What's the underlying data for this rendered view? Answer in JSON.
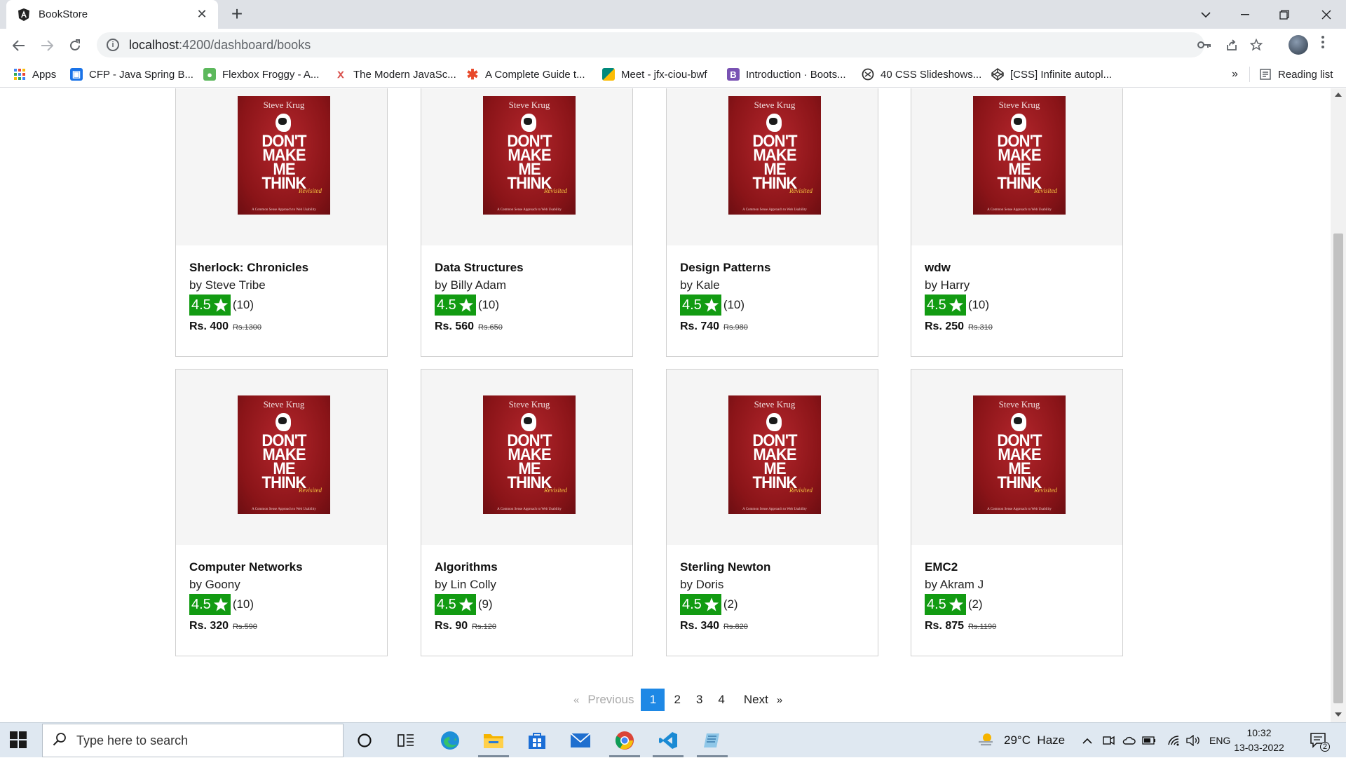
{
  "browser": {
    "tab_title": "BookStore",
    "tab_close": "✕",
    "new_tab": "+",
    "url_host": "localhost",
    "url_path": ":4200/dashboard/books",
    "reading_list": "Reading list",
    "bookmarks_more": "»"
  },
  "bookmarks": [
    {
      "label": "Apps",
      "icon": "apps-grid-icon",
      "color": "#4285f4"
    },
    {
      "label": "CFP - Java Spring B...",
      "icon": "cfp-icon",
      "color": "#1a73e8"
    },
    {
      "label": "Flexbox Froggy - A...",
      "icon": "frog-icon",
      "color": "#5cb85c"
    },
    {
      "label": "The Modern JavaSc...",
      "icon": "javascript-info-icon",
      "color": "#d9534f"
    },
    {
      "label": "A Complete Guide t...",
      "icon": "css-tricks-icon",
      "color": "#e8492a"
    },
    {
      "label": "Meet - jfx-ciou-bwf",
      "icon": "google-meet-icon",
      "color": "#00897b"
    },
    {
      "label": "Introduction · Boots...",
      "icon": "bootstrap-icon",
      "color": "#7952b3"
    },
    {
      "label": "40 CSS Slideshows...",
      "icon": "slideshow-icon",
      "color": "#333333"
    },
    {
      "label": "[CSS] Infinite autopl...",
      "icon": "codepen-icon",
      "color": "#333333"
    }
  ],
  "books": [
    {
      "title": "Sherlock: Chronicles",
      "author": "by Steve Tribe",
      "rating": "4.5",
      "reviews": "(10)",
      "price": "Rs. 400",
      "old_price": "Rs.1300"
    },
    {
      "title": "Data Structures",
      "author": "by Billy Adam",
      "rating": "4.5",
      "reviews": "(10)",
      "price": "Rs. 560",
      "old_price": "Rs.650"
    },
    {
      "title": "Design Patterns",
      "author": "by Kale",
      "rating": "4.5",
      "reviews": "(10)",
      "price": "Rs. 740",
      "old_price": "Rs.980"
    },
    {
      "title": "wdw",
      "author": "by Harry",
      "rating": "4.5",
      "reviews": "(10)",
      "price": "Rs. 250",
      "old_price": "Rs.310"
    },
    {
      "title": "Computer Networks",
      "author": "by Goony",
      "rating": "4.5",
      "reviews": "(10)",
      "price": "Rs. 320",
      "old_price": "Rs.590"
    },
    {
      "title": "Algorithms",
      "author": "by Lin Colly",
      "rating": "4.5",
      "reviews": "(9)",
      "price": "Rs. 90",
      "old_price": "Rs.120"
    },
    {
      "title": "Sterling Newton",
      "author": "by Doris",
      "rating": "4.5",
      "reviews": "(2)",
      "price": "Rs. 340",
      "old_price": "Rs.820"
    },
    {
      "title": "EMC2",
      "author": "by Akram J",
      "rating": "4.5",
      "reviews": "(2)",
      "price": "Rs. 875",
      "old_price": "Rs.1190"
    }
  ],
  "cover": {
    "author": "Steve Krug",
    "title_lines": [
      "DON'T",
      "MAKE",
      "ME",
      "THINK"
    ],
    "revisited": "Revisited",
    "subtitle": "A Common Sense Approach to Web Usability"
  },
  "pagination": {
    "prev_arrow": "«",
    "previous": "Previous",
    "pages": [
      "1",
      "2",
      "3",
      "4"
    ],
    "active": "1",
    "next": "Next",
    "next_arrow": "»"
  },
  "taskbar": {
    "search_placeholder": "Type here to search",
    "weather": "29°C  Haze",
    "language": "ENG",
    "time": "10:32",
    "date": "13-03-2022",
    "notifications": "2"
  },
  "colors": {
    "rating_green": "#129b12",
    "active_page": "#1e88e5",
    "cover_red": "#8a1418"
  }
}
